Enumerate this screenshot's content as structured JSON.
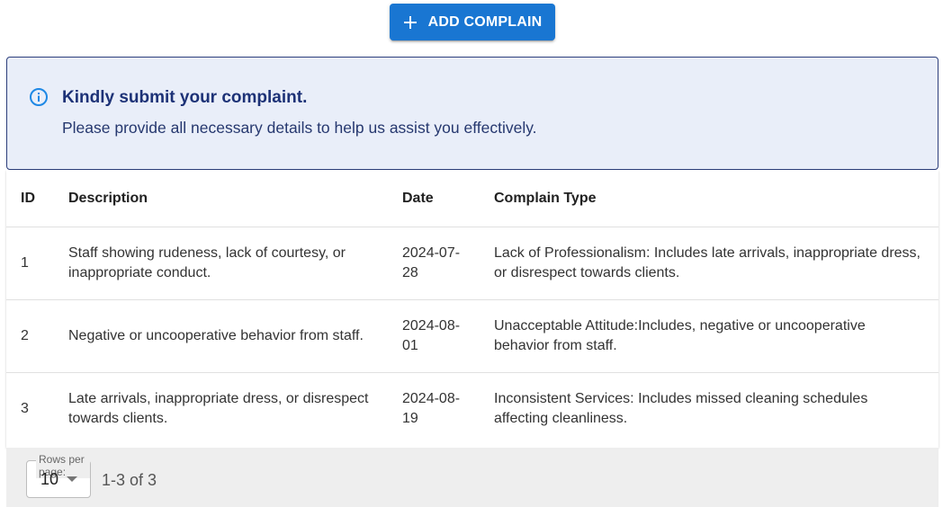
{
  "toolbar": {
    "add_label": "ADD COMPLAIN"
  },
  "alert": {
    "title": "Kindly submit your complaint.",
    "message": "Please provide all necessary details to help us assist you effectively."
  },
  "table": {
    "headers": {
      "id": "ID",
      "description": "Description",
      "date": "Date",
      "type": "Complain Type"
    },
    "rows": [
      {
        "id": "1",
        "description": "Staff showing rudeness, lack of courtesy, or inappropriate conduct.",
        "date": "2024-07-28",
        "type": "Lack of Professionalism: Includes late arrivals, inappropriate dress, or disrespect towards clients."
      },
      {
        "id": "2",
        "description": "Negative or uncooperative behavior from staff.",
        "date": "2024-08-01",
        "type": "Unacceptable Attitude:Includes, negative or uncooperative behavior from staff."
      },
      {
        "id": "3",
        "description": "Late arrivals, inappropriate dress, or disrespect towards clients.",
        "date": "2024-08-19",
        "type": "Inconsistent Services: Includes missed cleaning schedules affecting cleanliness."
      }
    ]
  },
  "pagination": {
    "rows_per_page_label": "Rows per page:",
    "rows_per_page_value": "10",
    "range_text": "1-3 of 3"
  },
  "colors": {
    "primary": "#1976d2",
    "alert_background": "#e9eef9",
    "alert_border": "#2c3e7b",
    "alert_title": "#1d3277",
    "info_icon": "#1e88e5"
  },
  "icons": {
    "add": "plus-icon",
    "info": "info-icon",
    "dropdown": "arrow-drop-down-icon"
  }
}
